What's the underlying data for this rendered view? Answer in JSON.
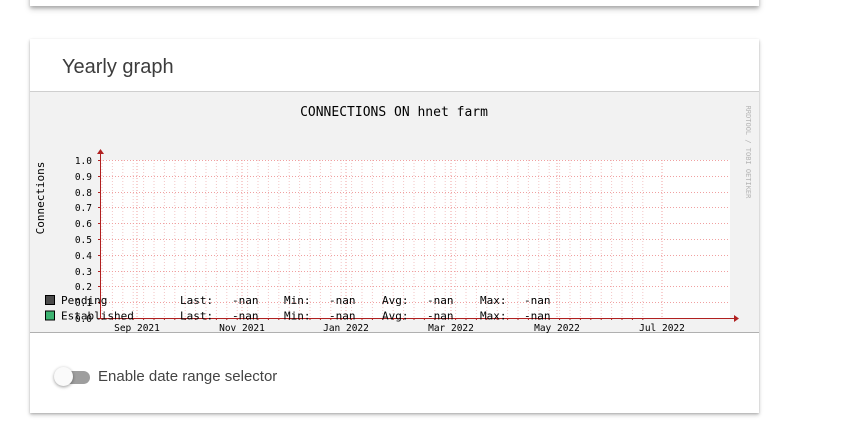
{
  "card": {
    "title": "Yearly graph"
  },
  "graph": {
    "title": "CONNECTIONS ON hnet farm",
    "watermark": "RRDTOOL / TOBI OETIKER",
    "ylabel": "Connections",
    "legend": [
      {
        "name": "Pending",
        "color": "#4a4a4a",
        "last": "-nan",
        "min": "-nan",
        "avg": "-nan",
        "max": "-nan"
      },
      {
        "name": "Established",
        "color": "#3cb371",
        "last": "-nan",
        "min": "-nan",
        "avg": "-nan",
        "max": "-nan"
      }
    ],
    "stat_labels": {
      "last": "Last:",
      "min": "Min:",
      "avg": "Avg:",
      "max": "Max:"
    }
  },
  "chart_data": {
    "type": "line",
    "title": "CONNECTIONS ON hnet farm",
    "xlabel": "",
    "ylabel": "Connections",
    "ylim": [
      0.0,
      1.0
    ],
    "yticks": [
      "0.0",
      "0.1",
      "0.2",
      "0.3",
      "0.4",
      "0.5",
      "0.6",
      "0.7",
      "0.8",
      "0.9",
      "1.0"
    ],
    "xticks": [
      "Sep 2021",
      "Nov 2021",
      "Jan 2022",
      "Mar 2022",
      "May 2022",
      "Jul 2022"
    ],
    "grid": true,
    "series": [
      {
        "name": "Pending",
        "values": []
      },
      {
        "name": "Established",
        "values": []
      }
    ]
  },
  "toggle": {
    "label": "Enable date range selector",
    "state": "off"
  }
}
